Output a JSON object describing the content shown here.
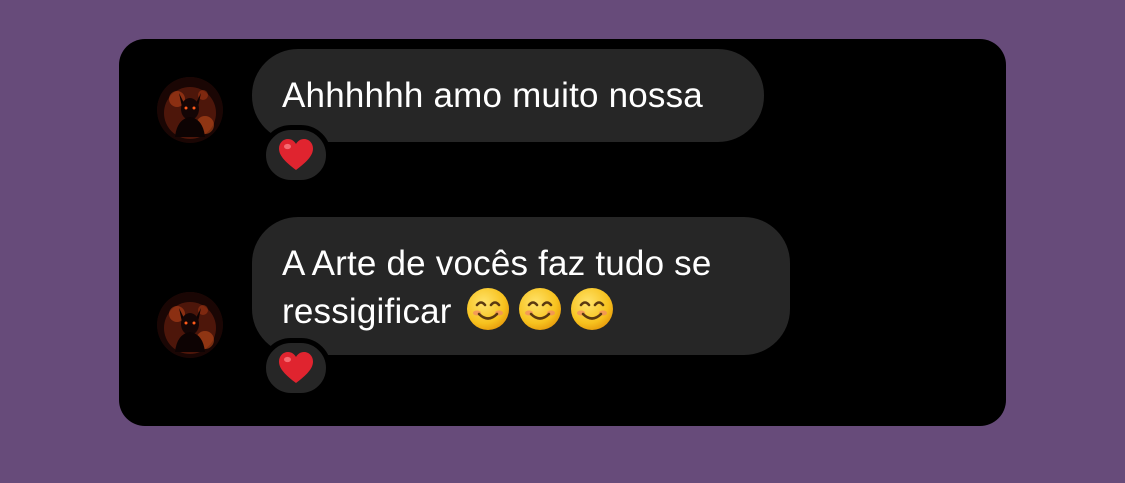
{
  "conversation": {
    "messages": [
      {
        "text": "Ahhhhhh amo muito nossa",
        "reaction": "heart-emoji"
      },
      {
        "line1": "A Arte de vocês faz tudo se",
        "line2": "ressigificar",
        "trailing_emoji": [
          "smiling-face-emoji",
          "smiling-face-emoji",
          "smiling-face-emoji"
        ],
        "reaction": "heart-emoji"
      }
    ]
  },
  "colors": {
    "page_background": "#674b7a",
    "card_background": "#000000",
    "bubble_background": "#262626",
    "text": "#ffffff",
    "heart": "#e0242f"
  }
}
